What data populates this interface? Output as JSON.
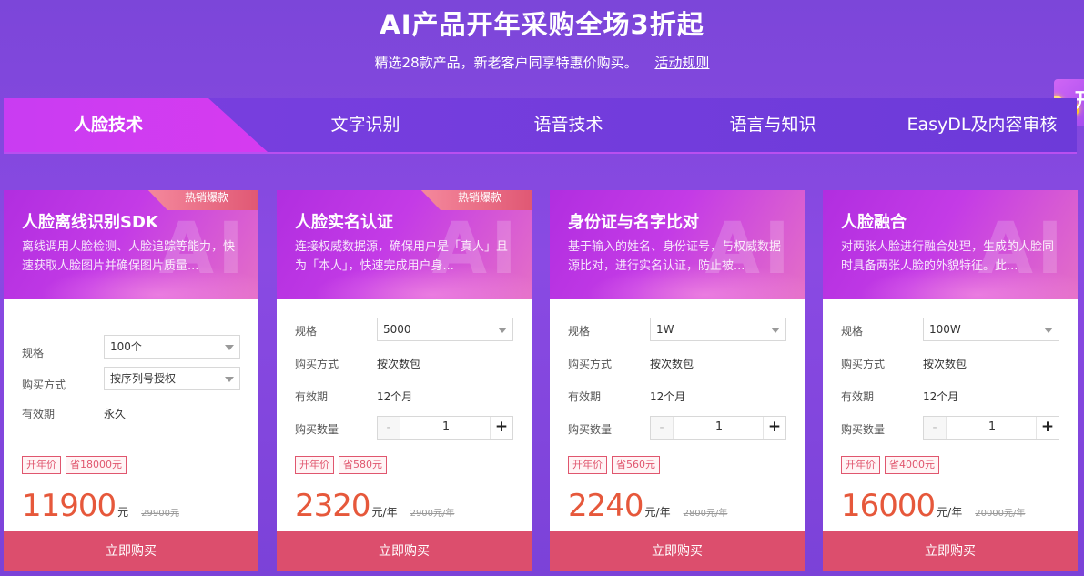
{
  "hero": {
    "title": "AI产品开年采购全场3折起",
    "subtitle": "精选28款产品，新老客户同享特惠价购买。",
    "rules_link": "活动规则"
  },
  "tabs": [
    {
      "label": "人脸技术",
      "active": true
    },
    {
      "label": "文字识别",
      "active": false
    },
    {
      "label": "语音技术",
      "active": false
    },
    {
      "label": "语言与知识",
      "active": false
    },
    {
      "label": "EasyDL及内容审核",
      "active": false
    }
  ],
  "labels": {
    "spec": "规格",
    "purchase_method": "购买方式",
    "validity": "有效期",
    "quantity": "购买数量",
    "buy": "立即购买",
    "hot": "热销爆款",
    "promo_tag": "开年价",
    "ai_watermark": "AI"
  },
  "cards": [
    {
      "name": "人脸离线识别SDK",
      "desc": "离线调用人脸检测、人脸追踪等能力，快速获取人脸图片并确保图片质量...",
      "hot": true,
      "spec": "100个",
      "purchase_method": "按序列号授权",
      "validity": "永久",
      "quantity": null,
      "save": "省18000元",
      "price": "11900",
      "unit": "元",
      "original": "29900元"
    },
    {
      "name": "人脸实名认证",
      "desc": "连接权威数据源，确保用户是「真人」且为「本人」，快速完成用户身...",
      "hot": true,
      "spec": "5000",
      "purchase_method": "按次数包",
      "validity": "12个月",
      "quantity": "1",
      "save": "省580元",
      "price": "2320",
      "unit": "元/年",
      "original": "2900元/年"
    },
    {
      "name": "身份证与名字比对",
      "desc": "基于输入的姓名、身份证号，与权威数据源比对，进行实名认证，防止被...",
      "hot": false,
      "spec": "1W",
      "purchase_method": "按次数包",
      "validity": "12个月",
      "quantity": "1",
      "save": "省560元",
      "price": "2240",
      "unit": "元/年",
      "original": "2800元/年"
    },
    {
      "name": "人脸融合",
      "desc": "对两张人脸进行融合处理，生成的人脸同时具备两张人脸的外貌特征。此...",
      "hot": false,
      "spec": "100W",
      "purchase_method": "按次数包",
      "validity": "12个月",
      "quantity": "1",
      "save": "省4000元",
      "price": "16000",
      "unit": "元/年",
      "original": "20000元/年"
    }
  ],
  "colors": {
    "background": "#7c46d9",
    "active_tab": "#d63bf0",
    "price": "#e6583b",
    "buy_button": "#dc4e6d",
    "tag": "#e0566e"
  }
}
